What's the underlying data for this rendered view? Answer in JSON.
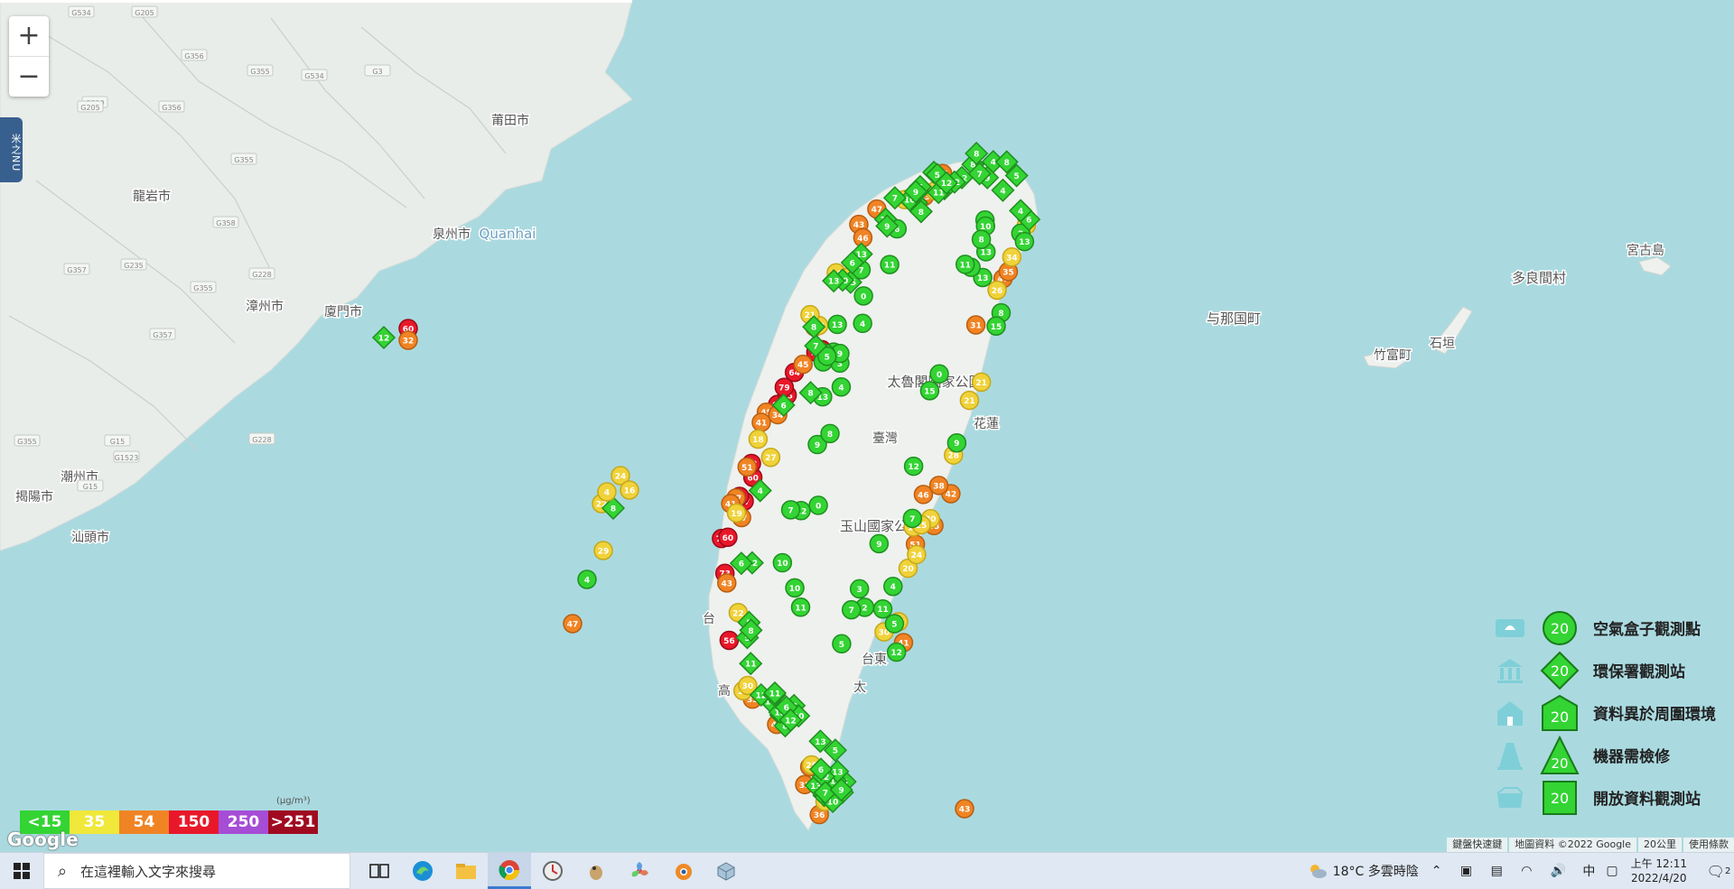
{
  "map": {
    "zoom_in_label": "+",
    "zoom_out_label": "−",
    "side_tab_label": "米之NU",
    "colors": {
      "sea": "#aadae0",
      "land_china": "#e8ecea",
      "land_taiwan": "#eef1ee",
      "green": "#33d433",
      "yellow": "#f0d23a",
      "orange": "#f08424",
      "red": "#e8182a",
      "purple": "#a64dd6",
      "maroon": "#a00a20"
    },
    "places": [
      {
        "name": "莆田市"
      },
      {
        "name": "龍岩市"
      },
      {
        "name": "泉州市"
      },
      {
        "name": "Quanhai"
      },
      {
        "name": "漳州市"
      },
      {
        "name": "廈門市"
      },
      {
        "name": "潮州市"
      },
      {
        "name": "揭陽市"
      },
      {
        "name": "汕頭市"
      },
      {
        "name": "太魯閣國家公園"
      },
      {
        "name": "臺灣"
      },
      {
        "name": "玉山國家公園"
      },
      {
        "name": "台東"
      },
      {
        "name": "太"
      },
      {
        "name": "高"
      },
      {
        "name": "台"
      },
      {
        "name": "玉"
      },
      {
        "name": "花蓮"
      },
      {
        "name": "与那国町"
      },
      {
        "name": "多良間村"
      },
      {
        "name": "宮古島"
      },
      {
        "name": "竹富町"
      },
      {
        "name": "石垣"
      }
    ],
    "road_labels": [
      "G534",
      "G205",
      "G356",
      "G355",
      "G534",
      "G3",
      "G319",
      "G356",
      "G355",
      "G358",
      "G357",
      "G235",
      "G355",
      "G228",
      "G357",
      "G15",
      "G1523",
      "G355",
      "G228",
      "G15",
      "G205"
    ]
  },
  "markers_north": [
    9,
    6,
    4,
    8,
    10,
    8,
    6,
    5,
    4,
    12,
    9,
    7,
    13,
    6,
    8,
    11,
    12,
    8,
    10,
    5,
    7,
    4,
    12,
    9
  ],
  "markers_west": [
    11,
    12,
    6,
    5,
    13,
    10,
    7,
    15,
    5,
    7,
    13,
    8,
    12,
    11,
    6,
    9,
    5,
    7,
    4,
    6,
    8,
    10,
    6,
    13,
    9
  ],
  "markers_south": [
    8,
    6,
    10,
    9,
    12,
    13,
    10,
    11,
    13,
    6,
    5,
    8,
    10,
    12,
    7,
    6,
    9,
    12
  ],
  "markers_east": [
    13,
    13,
    6,
    4,
    2,
    9,
    11,
    15,
    10,
    0,
    3,
    5,
    8,
    12,
    7
  ],
  "labeled_markers": {
    "red": [
      "60",
      "65",
      "71",
      "83",
      "79",
      "85",
      "67",
      "72",
      "64",
      "79",
      "60",
      "56",
      "66",
      "73"
    ],
    "orange": [
      "32",
      "45",
      "46",
      "43",
      "42",
      "37",
      "51",
      "47",
      "41",
      "38",
      "45",
      "51",
      "34",
      "36",
      "47",
      "31",
      "43",
      "42",
      "53",
      "35",
      "41",
      "45",
      "54",
      "46",
      "33",
      "37",
      "41",
      "47",
      "43",
      "35"
    ],
    "yellow": [
      "25",
      "30",
      "21",
      "17",
      "20",
      "28",
      "24",
      "16",
      "22",
      "26",
      "29",
      "18",
      "19",
      "21",
      "27",
      "24",
      "19",
      "30",
      "34",
      "33",
      "29",
      "23",
      "22",
      "17",
      "21",
      "30",
      "24",
      "25"
    ],
    "green": [
      "0",
      "3",
      "4",
      "9",
      "0",
      "5",
      "11",
      "13",
      "11",
      "2",
      "0",
      "8",
      "7",
      "6",
      "9",
      "4",
      "12",
      "11",
      "13",
      "10",
      "7",
      "3",
      "9",
      "6",
      "5",
      "13",
      "8",
      "12",
      "15",
      "10",
      "4",
      "7"
    ]
  },
  "islands": {
    "kinmen": [
      "60",
      "12",
      "32"
    ],
    "penghu": [
      "24",
      "16",
      "22",
      "8",
      "4",
      "29",
      "4"
    ],
    "offshore": [
      "47",
      "43",
      "4"
    ]
  },
  "legend": {
    "items": [
      {
        "label": "空氣盒子觀測點",
        "value": "20",
        "icon": "airbox-icon",
        "mark": "circle"
      },
      {
        "label": "環保署觀測站",
        "value": "20",
        "icon": "government-icon",
        "mark": "diamond"
      },
      {
        "label": "資料異於周圍環境",
        "value": "20",
        "icon": "house-icon",
        "mark": "pentagon"
      },
      {
        "label": "機器需檢修",
        "value": "20",
        "icon": "cone-icon",
        "mark": "triangle"
      },
      {
        "label": "開放資料觀測站",
        "value": "20",
        "icon": "openbox-icon",
        "mark": "square"
      }
    ]
  },
  "scale": {
    "unit": "(μg/m³)",
    "cells": [
      {
        "label": "<15",
        "color": "#33d433"
      },
      {
        "label": "35",
        "color": "#f0e83a"
      },
      {
        "label": "54",
        "color": "#f08424"
      },
      {
        "label": "150",
        "color": "#e8182a"
      },
      {
        "label": "250",
        "color": "#a64dd6"
      },
      {
        "label": ">251",
        "color": "#a00a20"
      }
    ]
  },
  "attribution": {
    "google": "Google",
    "shortcuts": "鍵盤快速鍵",
    "map_data": "地圖資料 ©2022 Google",
    "scale": "20公里",
    "terms": "使用條款"
  },
  "taskbar": {
    "search_placeholder": "在這裡輸入文字來搜尋",
    "apps": [
      "task-view-icon",
      "edge-icon",
      "file-explorer-icon",
      "chrome-icon",
      "clock-app-icon",
      "bird-icon",
      "fan-icon",
      "blender-icon",
      "cube-icon"
    ],
    "weather": "18°C  多雲時陰",
    "ime": "中",
    "time": "上午 12:11",
    "date": "2022/4/20",
    "notif_count": "2"
  }
}
